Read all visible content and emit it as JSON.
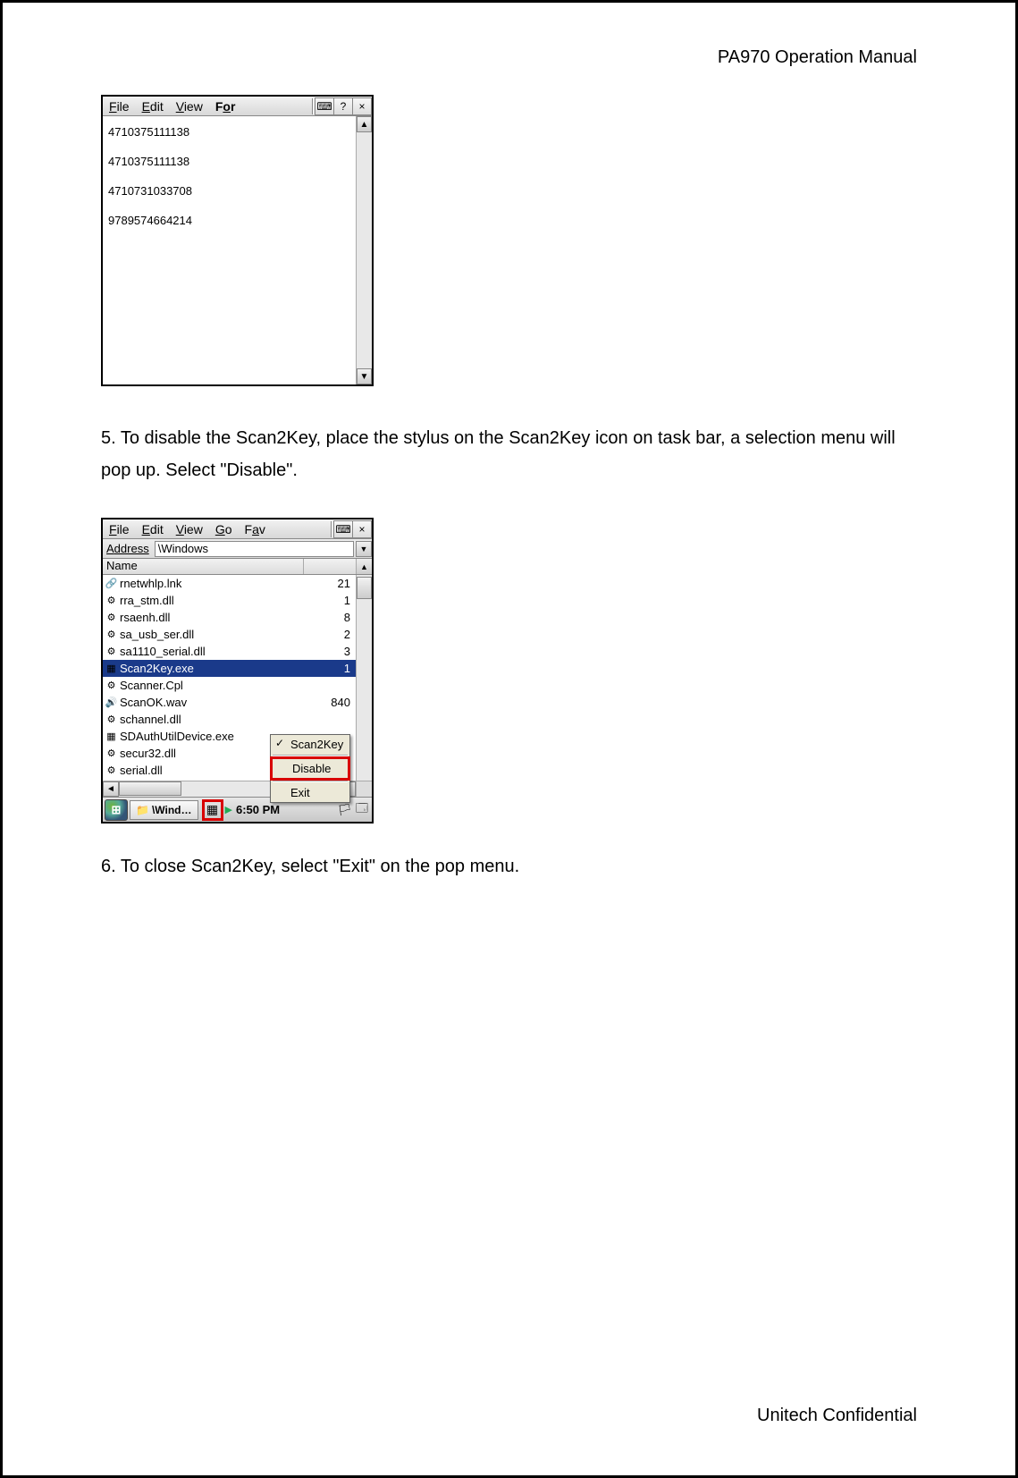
{
  "header": {
    "title": "PA970 Operation Manual"
  },
  "footer": {
    "text": "Unitech Confidential"
  },
  "win1": {
    "menu": {
      "file": "File",
      "edit": "Edit",
      "view": "View",
      "for": "For",
      "keyboard": "⌨",
      "help": "?",
      "close": "×"
    },
    "lines": [
      "4710375111138",
      "4710375111138",
      "4710731033708",
      "9789574664214"
    ]
  },
  "step5": "5. To disable the Scan2Key, place the stylus on the Scan2Key icon on task bar, a selection menu will pop up. Select \"Disable\".",
  "step6": "6. To close Scan2Key, select \"Exit\" on the pop menu.",
  "win2": {
    "menu": {
      "file": "File",
      "edit": "Edit",
      "view": "View",
      "go": "Go",
      "fav": "Fav",
      "keyboard": "⌨",
      "close": "×"
    },
    "address": {
      "label": "Address",
      "value": "\\Windows"
    },
    "cols": {
      "name": "Name"
    },
    "files": [
      {
        "icon": "lnk",
        "name": "rnetwhlp.lnk",
        "size": "21",
        "sel": false
      },
      {
        "icon": "dll",
        "name": "rra_stm.dll",
        "size": "1",
        "sel": false
      },
      {
        "icon": "dll",
        "name": "rsaenh.dll",
        "size": "8",
        "sel": false
      },
      {
        "icon": "dll",
        "name": "sa_usb_ser.dll",
        "size": "2",
        "sel": false
      },
      {
        "icon": "dll",
        "name": "sa1110_serial.dll",
        "size": "3",
        "sel": false
      },
      {
        "icon": "exe",
        "name": "Scan2Key.exe",
        "size": "1",
        "sel": true
      },
      {
        "icon": "dll",
        "name": "Scanner.Cpl",
        "size": "",
        "sel": false
      },
      {
        "icon": "wav",
        "name": "ScanOK.wav",
        "size": "840",
        "sel": false
      },
      {
        "icon": "dll",
        "name": "schannel.dll",
        "size": "",
        "sel": false
      },
      {
        "icon": "exe",
        "name": "SDAuthUtilDevice.exe",
        "size": "",
        "sel": false
      },
      {
        "icon": "dll",
        "name": "secur32.dll",
        "size": "",
        "sel": false
      },
      {
        "icon": "dll",
        "name": "serial.dll",
        "size": "",
        "sel": false
      }
    ],
    "popup": {
      "scan2key": "Scan2Key",
      "disable": "Disable",
      "exit": "Exit"
    },
    "taskbar": {
      "wind": "\\Wind…",
      "time": "6:50 PM",
      "startTip": "⊞"
    }
  }
}
